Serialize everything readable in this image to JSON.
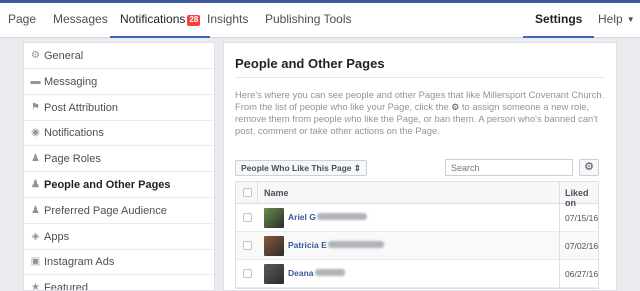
{
  "topnav": {
    "items": [
      {
        "label": "Page"
      },
      {
        "label": "Messages"
      },
      {
        "label": "Notifications",
        "badge": "28"
      },
      {
        "label": "Insights"
      },
      {
        "label": "Publishing Tools"
      }
    ],
    "settings": "Settings",
    "help": "Help",
    "help_caret": "▼"
  },
  "sidebar": {
    "items": [
      {
        "label": "General",
        "icon": "gear-icon",
        "glyph": "⚙"
      },
      {
        "label": "Messaging",
        "icon": "speech-bubbles-icon",
        "glyph": "▬"
      },
      {
        "label": "Post Attribution",
        "icon": "flag-icon",
        "glyph": "⚑"
      },
      {
        "label": "Notifications",
        "icon": "globe-icon",
        "glyph": "◉"
      },
      {
        "label": "Page Roles",
        "icon": "person-icon",
        "glyph": "♟"
      },
      {
        "label": "People and Other Pages",
        "icon": "people-icon",
        "glyph": "♟",
        "active": true
      },
      {
        "label": "Preferred Page Audience",
        "icon": "people-icon",
        "glyph": "♟"
      },
      {
        "label": "Apps",
        "icon": "apps-cube-icon",
        "glyph": "◈"
      },
      {
        "label": "Instagram Ads",
        "icon": "instagram-icon",
        "glyph": "▣"
      },
      {
        "label": "Featured",
        "icon": "star-icon",
        "glyph": "★"
      }
    ]
  },
  "main": {
    "title": "People and Other Pages",
    "desc_part1": "Here's where you can see people and other Pages that like Millersport Covenant Church. From the list of people who like your Page, click the",
    "desc_gear": "⚙",
    "desc_part2": "to assign someone a new role, remove them from people who like the Page, or ban them. A person who's banned can't post, comment or take other actions on the Page.",
    "filter_label": "People Who Like This Page ⇕",
    "search_placeholder": "Search",
    "gear_glyph": "⚙",
    "table": {
      "columns": [
        "Name",
        "Liked on"
      ],
      "rows": [
        {
          "name": "Ariel G",
          "date": "07/15/16",
          "avatar_color": "#6b8e4e"
        },
        {
          "name": "Patricia E",
          "date": "07/02/16",
          "avatar_color": "#8a5a3c"
        },
        {
          "name": "Deana",
          "date": "06/27/16",
          "avatar_color": "#5a5a5a"
        }
      ]
    }
  }
}
